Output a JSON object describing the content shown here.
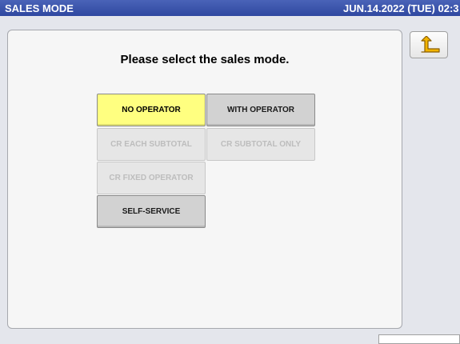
{
  "header": {
    "title": "SALES MODE",
    "datetime": "JUN.14.2022 (TUE) 02:3"
  },
  "main": {
    "prompt": "Please select the sales mode.",
    "buttons": {
      "no_operator": "NO OPERATOR",
      "with_operator": "WITH OPERATOR",
      "cr_each_subtotal": "CR EACH SUBTOTAL",
      "cr_subtotal_only": "CR SUBTOTAL ONLY",
      "cr_fixed_operator": "CR FIXED OPERATOR",
      "self_service": "SELF-SERVICE"
    },
    "selected": "NO OPERATOR"
  },
  "toolbar": {
    "back_icon": "return-arrow-icon"
  },
  "colors": {
    "titlebar": "#2f48a0",
    "selected_button": "#ffff80",
    "normal_button": "#d2d2d2",
    "disabled_text": "#bdbdbd",
    "back_arrow": "#e8a400"
  }
}
